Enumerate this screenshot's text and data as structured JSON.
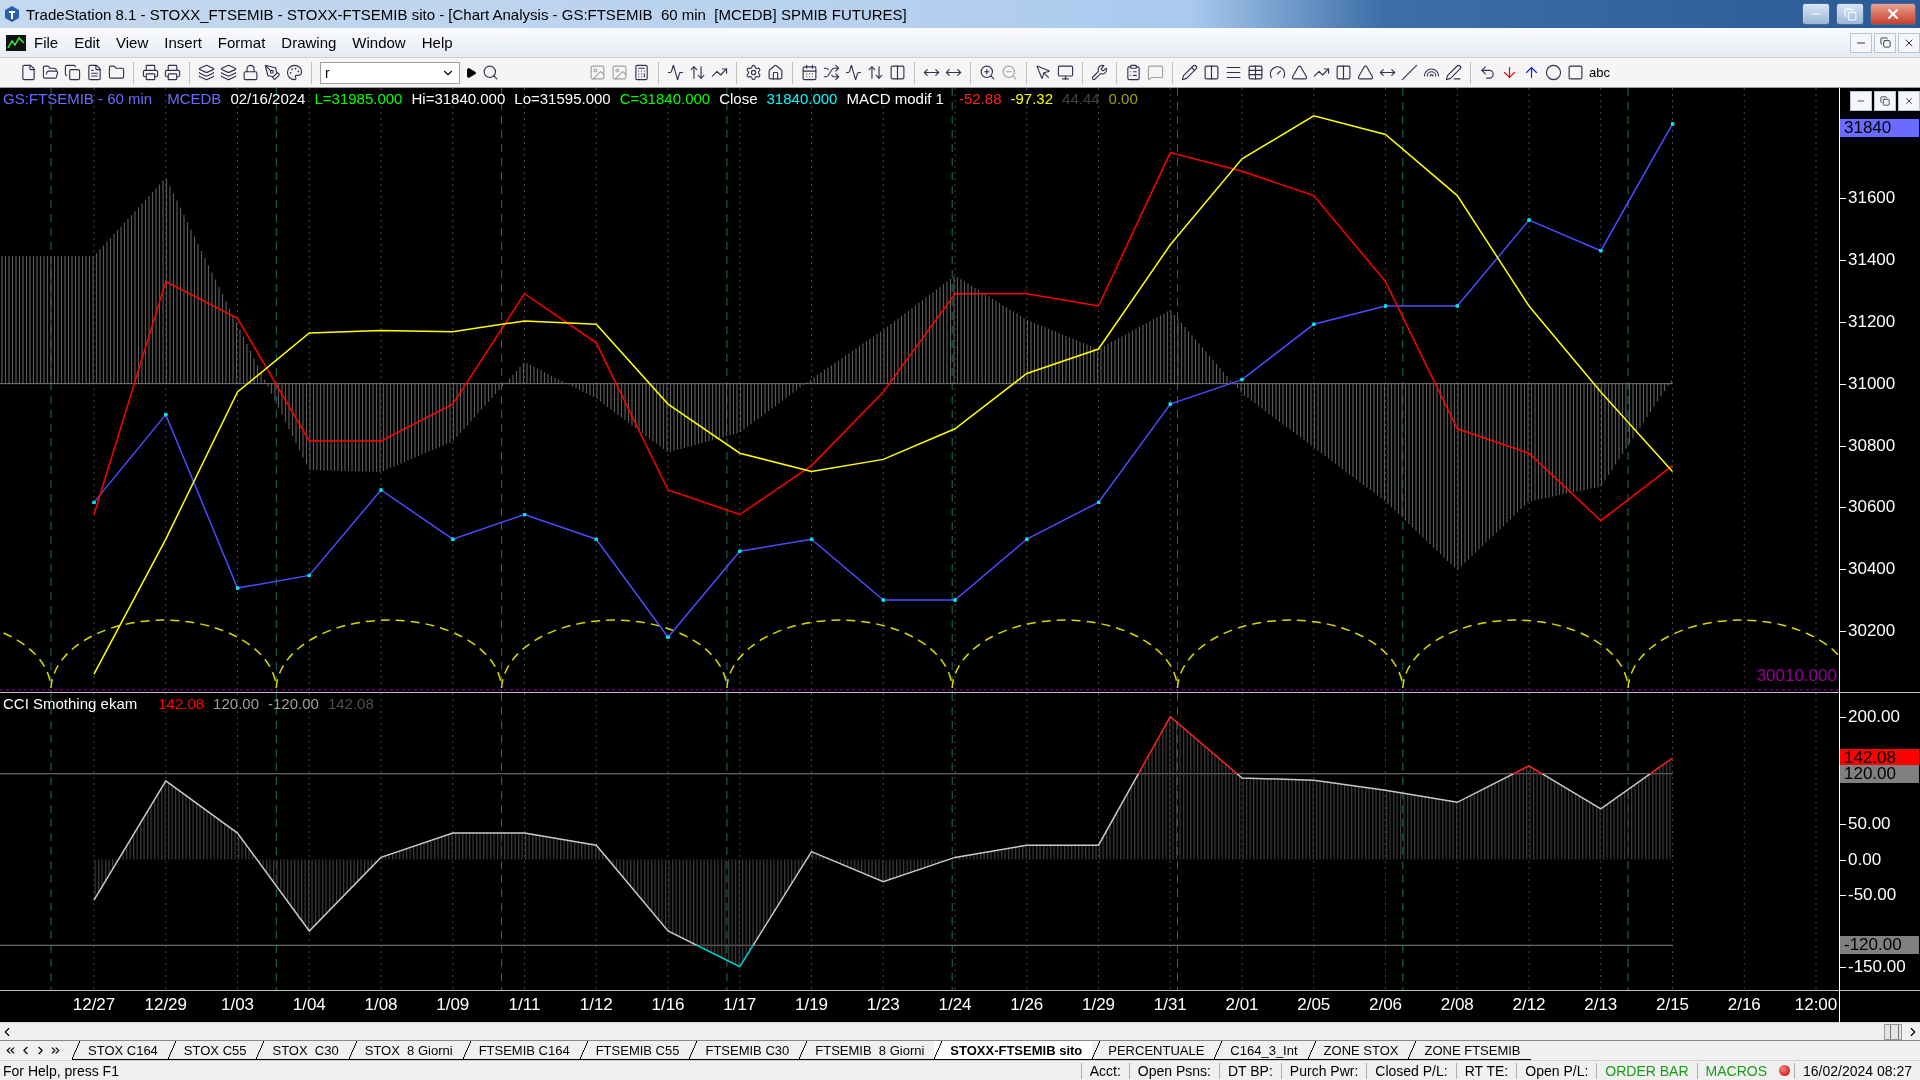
{
  "window": {
    "title": "TradeStation 8.1 - STOXX_FTSEMIB - STOXX-FTSEMIB sito - [Chart Analysis - GS:FTSEMIB  60 min  [MCEDB] SPMIB FUTURES]"
  },
  "menu": [
    "File",
    "Edit",
    "View",
    "Insert",
    "Format",
    "Drawing",
    "Window",
    "Help"
  ],
  "toolbar": {
    "symbol_field": {
      "value": "r"
    },
    "text_tool": "abc"
  },
  "price_pane": {
    "legend": [
      {
        "text": "GS:FTSEMIB - 60 min",
        "color": "#6b6bff"
      },
      {
        "text": "MCEDB",
        "color": "#6b6bff"
      },
      {
        "text": "02/16/2024",
        "color": "#ffffff"
      },
      {
        "text": "L=31985.000",
        "color": "#00ff00"
      },
      {
        "text": "Hi=31840.000",
        "color": "#ffffff"
      },
      {
        "text": "Lo=31595.000",
        "color": "#ffffff"
      },
      {
        "text": "C=31840.000",
        "color": "#00ff00"
      },
      {
        "text": "Close",
        "color": "#ffffff"
      },
      {
        "text": "31840.000",
        "color": "#00ffff"
      },
      {
        "text": "MACD modif 1",
        "color": "#ffffff"
      },
      {
        "text": "-52.88",
        "color": "#ff2020"
      },
      {
        "text": "-97.32",
        "color": "#ffff00"
      },
      {
        "text": "44.44",
        "color": "#404040"
      },
      {
        "text": "0.00",
        "color": "#a0a000"
      }
    ],
    "chart_data": {
      "type": "line",
      "ylim": [
        30003,
        31956
      ],
      "yticks": [
        31600,
        31400,
        31200,
        31000,
        30800,
        30600,
        30400,
        30200
      ],
      "series": [
        {
          "color": "#4b4bff",
          "values": [
            30616,
            30900,
            30339,
            30380,
            30656,
            30497,
            30577,
            30497,
            30180,
            30458,
            30497,
            30300,
            30300,
            30497,
            30616,
            30934,
            31013,
            31192,
            31251,
            31251,
            31529,
            31430,
            31840,
            null,
            null
          ]
        },
        {
          "color": "#ff0000",
          "values": [
            30577,
            31330,
            31211,
            30815,
            30815,
            30934,
            31291,
            31132,
            30656,
            30577,
            30735,
            30973,
            31291,
            31291,
            31251,
            31747,
            31687,
            31608,
            31330,
            30854,
            30775,
            30557,
            30735,
            null,
            null
          ]
        },
        {
          "color": "#ffff00",
          "values": [
            30061,
            30497,
            30973,
            31164,
            31172,
            31168,
            31203,
            31192,
            30934,
            30775,
            30716,
            30755,
            30854,
            31033,
            31112,
            31449,
            31727,
            31866,
            31806,
            31608,
            31251,
            30973,
            30716,
            null,
            null
          ]
        }
      ],
      "grid": true,
      "ref_lines": [
        {
          "axis": "y",
          "value": 31000
        },
        {
          "axis": "y",
          "value": 30010
        }
      ],
      "annotations": [
        "31840",
        "30010.000"
      ]
    }
  },
  "cci_pane": {
    "legend": [
      {
        "text": "CCI Smothing ekam",
        "color": "#ffffff"
      },
      {
        "text": "142.08",
        "color": "#ff0000"
      },
      {
        "text": "120.00",
        "color": "#a0a0a0"
      },
      {
        "text": "-120.00",
        "color": "#a0a0a0"
      },
      {
        "text": "142.08",
        "color": "#505050"
      }
    ],
    "chart_data": {
      "type": "area",
      "categories": [
        "12/27",
        "12/29",
        "1/03",
        "1/04",
        "1/08",
        "1/09",
        "1/11",
        "1/12",
        "1/16",
        "1/17",
        "1/19",
        "1/23",
        "1/24",
        "1/26",
        "1/29",
        "1/31",
        "2/01",
        "2/05",
        "2/06",
        "2/08",
        "2/12",
        "2/13",
        "2/15",
        "2/16",
        "12:00"
      ],
      "ylim": [
        -184,
        233
      ],
      "yticks": [
        {
          "value": 200,
          "label": "200.00"
        },
        {
          "value": 50,
          "label": "50.00"
        },
        {
          "value": 0,
          "label": "0.00"
        },
        {
          "value": -50,
          "label": "-50.00"
        },
        {
          "value": -150,
          "label": "-150.00"
        }
      ],
      "series": [
        {
          "color": "#c8c8c8",
          "values": [
            -57,
            110,
            37,
            -100,
            3,
            37,
            37,
            20,
            -100,
            -150,
            11,
            -31,
            3,
            20,
            20,
            200,
            114,
            111,
            97,
            80,
            131,
            71,
            142,
            null,
            null
          ]
        }
      ],
      "grid": true,
      "ref_lines": [
        {
          "axis": "y",
          "value": 120
        },
        {
          "axis": "y",
          "value": -120
        }
      ],
      "annotations": [
        "142.08",
        "120.00",
        "-120.00"
      ]
    }
  },
  "tabs": [
    {
      "label": "STOX C164",
      "selected": false
    },
    {
      "label": "STOX C55",
      "selected": false
    },
    {
      "label": "STOX  C30",
      "selected": false
    },
    {
      "label": "STOX  8 Giorni",
      "selected": false
    },
    {
      "label": "FTSEMIB C164",
      "selected": false
    },
    {
      "label": "FTSEMIB C55",
      "selected": false
    },
    {
      "label": "FTSEMIB C30",
      "selected": false
    },
    {
      "label": "FTSEMIB  8 Giorni",
      "selected": false
    },
    {
      "label": "STOXX-FTSEMIB sito",
      "selected": true
    },
    {
      "label": "PERCENTUALE",
      "selected": false
    },
    {
      "label": "C164_3_Int",
      "selected": false
    },
    {
      "label": "ZONE STOX",
      "selected": false
    },
    {
      "label": "ZONE FTSEMIB",
      "selected": false
    }
  ],
  "status_bar": {
    "help": "For Help, press F1",
    "fields": [
      "Acct:",
      "Open Psns:",
      "DT BP:",
      "Purch Pwr:",
      "Closed P/L:",
      "RT TE:",
      "Open P/L:"
    ],
    "order_bar": "ORDER BAR",
    "macros": "MACROS",
    "datetime": "16/02/2024 08:27"
  }
}
